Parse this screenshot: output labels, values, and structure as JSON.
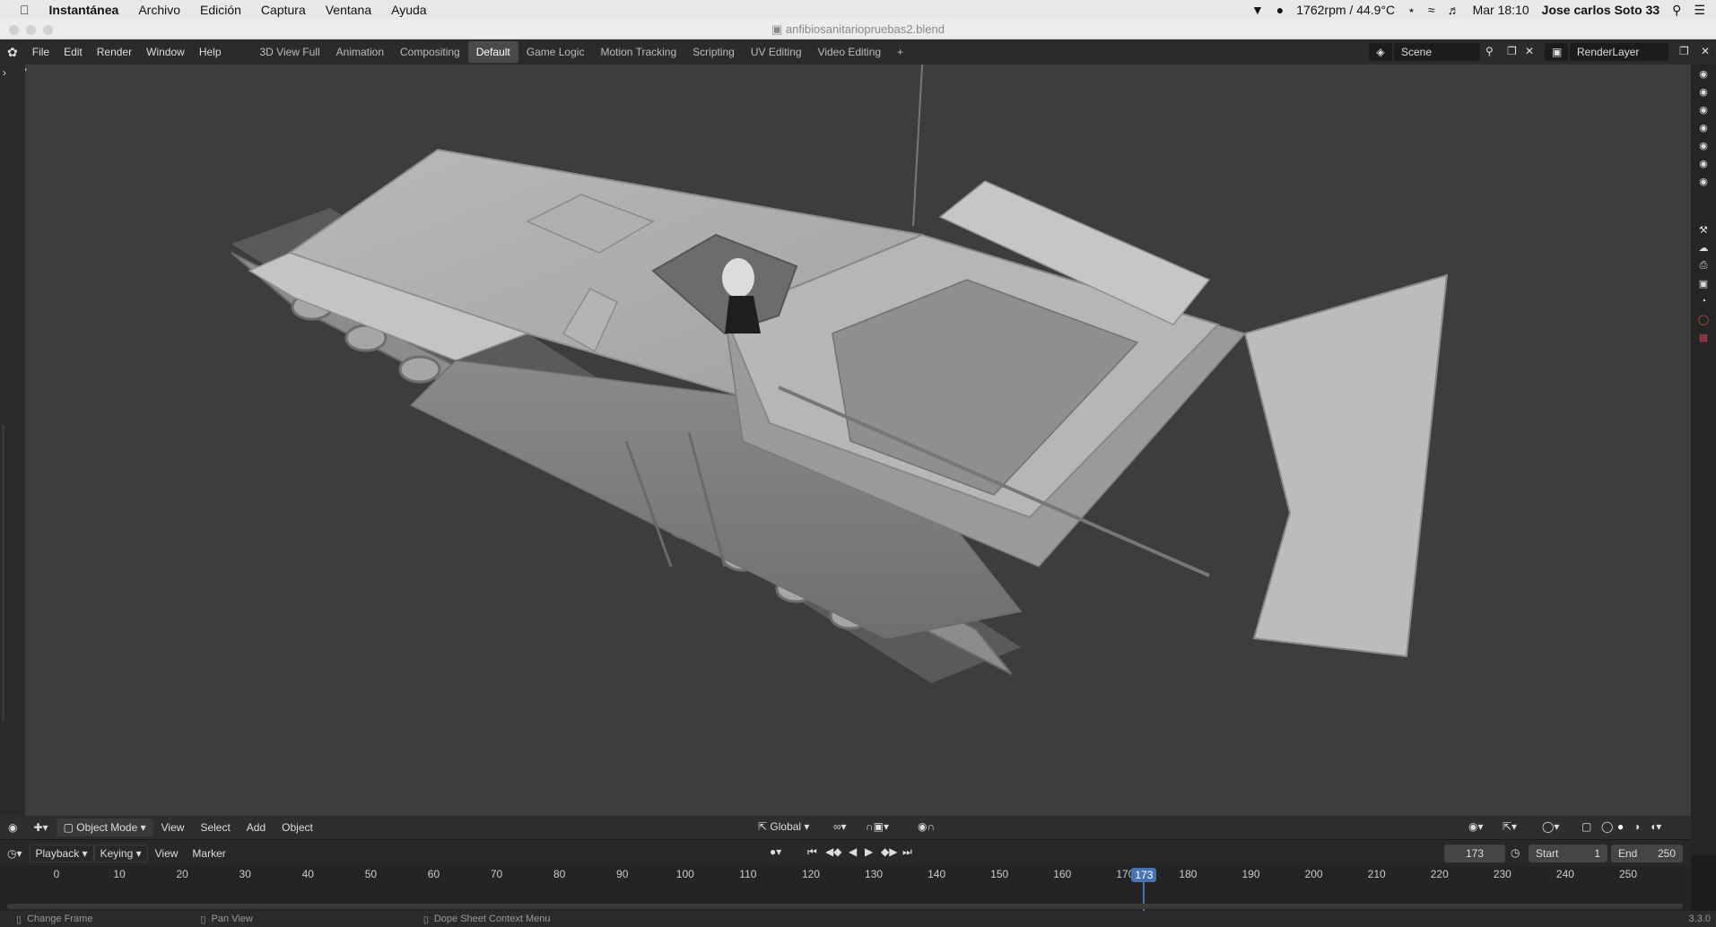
{
  "mac_menubar": {
    "apple": "",
    "app": "Instantánea",
    "items": [
      "Archivo",
      "Edición",
      "Captura",
      "Ventana",
      "Ayuda"
    ],
    "status_fan": "1762rpm / 44.9°C",
    "clock": "Mar 18:10",
    "user": "Jose carlos Soto 33"
  },
  "window": {
    "title": "anfibiosanitariopruebas2.blend"
  },
  "topbar": {
    "menus": [
      "File",
      "Edit",
      "Render",
      "Window",
      "Help"
    ],
    "workspaces": [
      "3D View Full",
      "Animation",
      "Compositing",
      "Default",
      "Game Logic",
      "Motion Tracking",
      "Scripting",
      "UV Editing",
      "Video Editing"
    ],
    "active_workspace": "Default",
    "add_label": "+",
    "scene": "Scene",
    "render_layer": "RenderLayer"
  },
  "viewport_header": {
    "mode": "Object Mode",
    "menus": [
      "View",
      "Select",
      "Add",
      "Object"
    ],
    "transform_orientation": "Global"
  },
  "timeline_header": {
    "playback": "Playback",
    "keying": "Keying",
    "view": "View",
    "marker": "Marker",
    "current_frame": "173",
    "start_label": "Start",
    "start_value": "1",
    "end_label": "End",
    "end_value": "250"
  },
  "ruler": {
    "ticks": [
      "0",
      "10",
      "20",
      "30",
      "40",
      "50",
      "60",
      "70",
      "80",
      "90",
      "100",
      "110",
      "120",
      "130",
      "140",
      "150",
      "160",
      "170",
      "180",
      "190",
      "200",
      "210",
      "220",
      "230",
      "240",
      "250"
    ],
    "current": "173"
  },
  "statusbar": {
    "items": [
      "Change Frame",
      "Pan View",
      "Dope Sheet Context Menu"
    ],
    "version": "3.3.0"
  }
}
